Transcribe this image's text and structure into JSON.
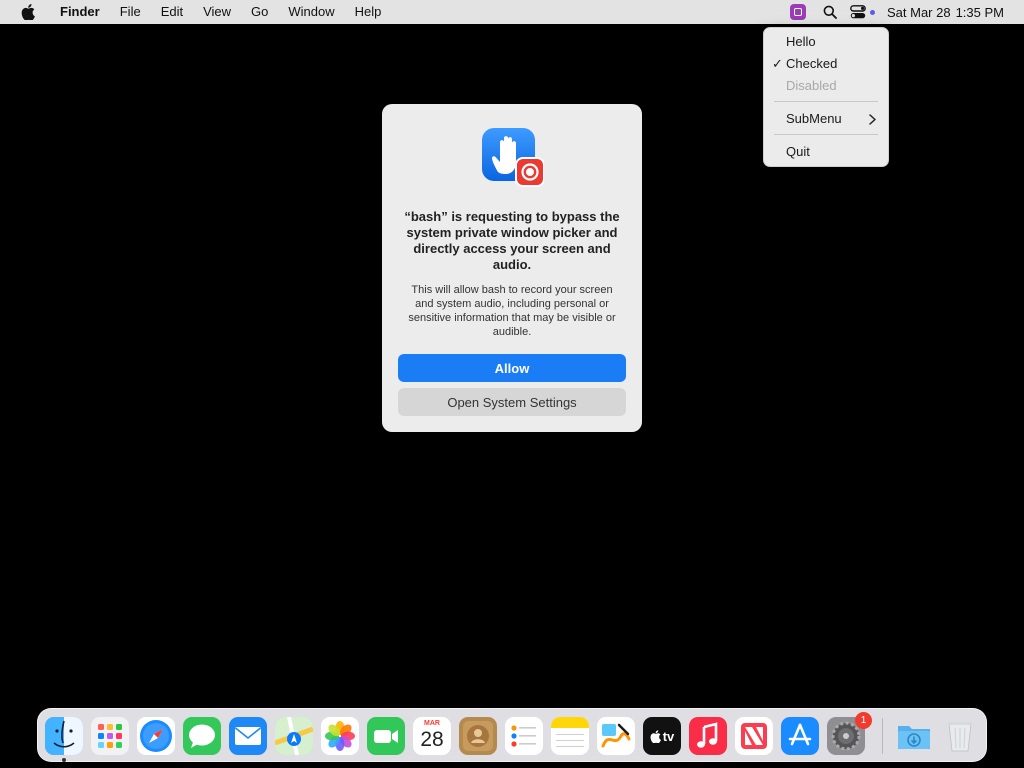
{
  "menubar": {
    "app_name": "Finder",
    "menus": [
      "File",
      "Edit",
      "View",
      "Go",
      "Window",
      "Help"
    ],
    "clock_date": "Sat Mar 28",
    "clock_time": "1:35 PM"
  },
  "dropdown": {
    "items": [
      {
        "label": "Hello",
        "checked": false,
        "disabled": false
      },
      {
        "label": "Checked",
        "checked": true,
        "disabled": false
      },
      {
        "label": "Disabled",
        "checked": false,
        "disabled": true
      },
      {
        "label": "SubMenu",
        "has_submenu": true
      },
      {
        "label": "Quit"
      }
    ],
    "check_glyph": "✓",
    "chevron_glyph": "›"
  },
  "dialog": {
    "title": "“bash” is requesting to bypass the system private window picker and directly access your screen and audio.",
    "body": "This will allow bash to record your screen and system audio, including personal or sensitive information that may be visible or audible.",
    "allow_label": "Allow",
    "settings_label": "Open System Settings"
  },
  "dock": {
    "calendar_month": "MAR",
    "calendar_day": "28",
    "tv_label": "tv",
    "settings_badge": "1",
    "apps": [
      "finder-icon",
      "launchpad-icon",
      "safari-icon",
      "messages-icon",
      "mail-icon",
      "maps-icon",
      "photos-icon",
      "facetime-icon",
      "calendar-icon",
      "contacts-icon",
      "reminders-icon",
      "notes-icon",
      "freeform-icon",
      "tv-icon",
      "music-icon",
      "news-icon",
      "app-store-icon",
      "system-settings-icon",
      "downloads-folder-icon",
      "trash-icon"
    ]
  },
  "colors": {
    "accent": "#1a7df5",
    "menubar": "#e3e3e3",
    "dialog_bg": "#ececec",
    "badge": "#f23b2f"
  }
}
